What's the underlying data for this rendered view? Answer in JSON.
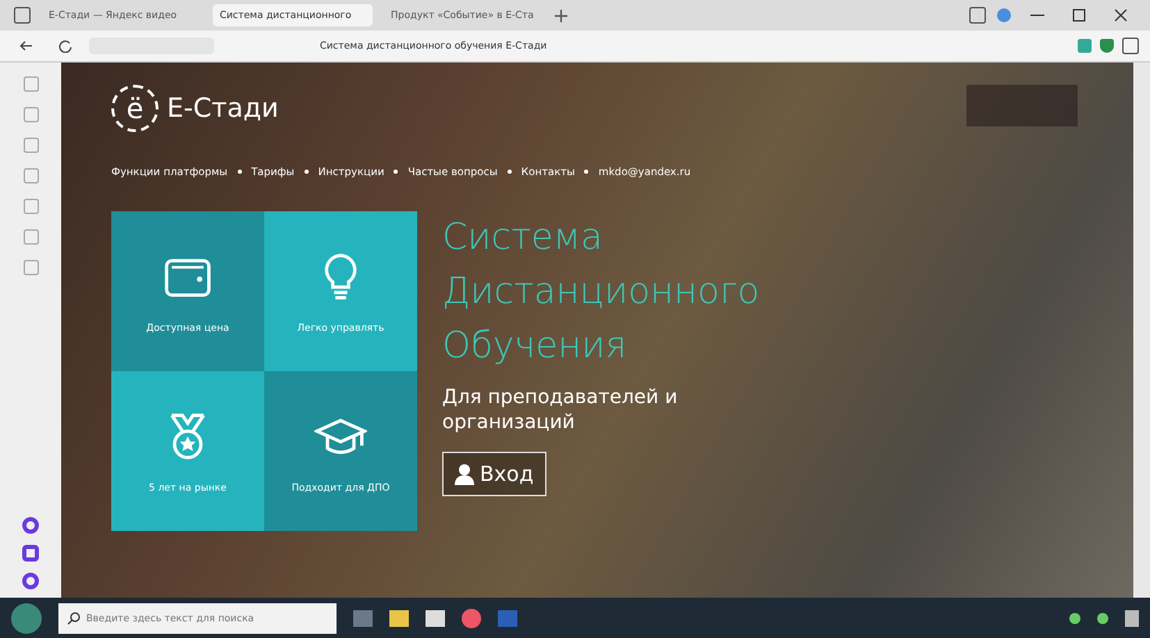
{
  "browser": {
    "tabs": [
      {
        "title": "Е-Стади — Яндекс видео",
        "selected": false
      },
      {
        "title": "Система дистанционного",
        "selected": true
      },
      {
        "title": "Продукт «Событие» в Е-Ста",
        "selected": false
      }
    ],
    "page_title": "Система дистанционного обучения Е-Стади"
  },
  "site": {
    "logo_mark": "ё",
    "logo_text": "Е-Стади",
    "nav": [
      "Функции платформы",
      "Тарифы",
      "Инструкции",
      "Частые вопросы",
      "Контакты",
      "mkdo@yandex.ru"
    ],
    "tiles": [
      {
        "kind": "wallet",
        "label": "Доступная цена",
        "color": "#1f8e98"
      },
      {
        "kind": "bulb",
        "label": "Легко управлять",
        "color": "#25b4bd"
      },
      {
        "kind": "medal",
        "label": "5 лет на рынке",
        "color": "#25b4bd"
      },
      {
        "kind": "cap",
        "label": "Подходит для ДПО",
        "color": "#1f8e98"
      }
    ],
    "heading": [
      "Система",
      "Дистанционного",
      "Обучения"
    ],
    "subtitle": "Для преподавателей и организаций",
    "login": "Вход"
  },
  "taskbar": {
    "search_placeholder": "Введите здесь текст для поиска"
  }
}
